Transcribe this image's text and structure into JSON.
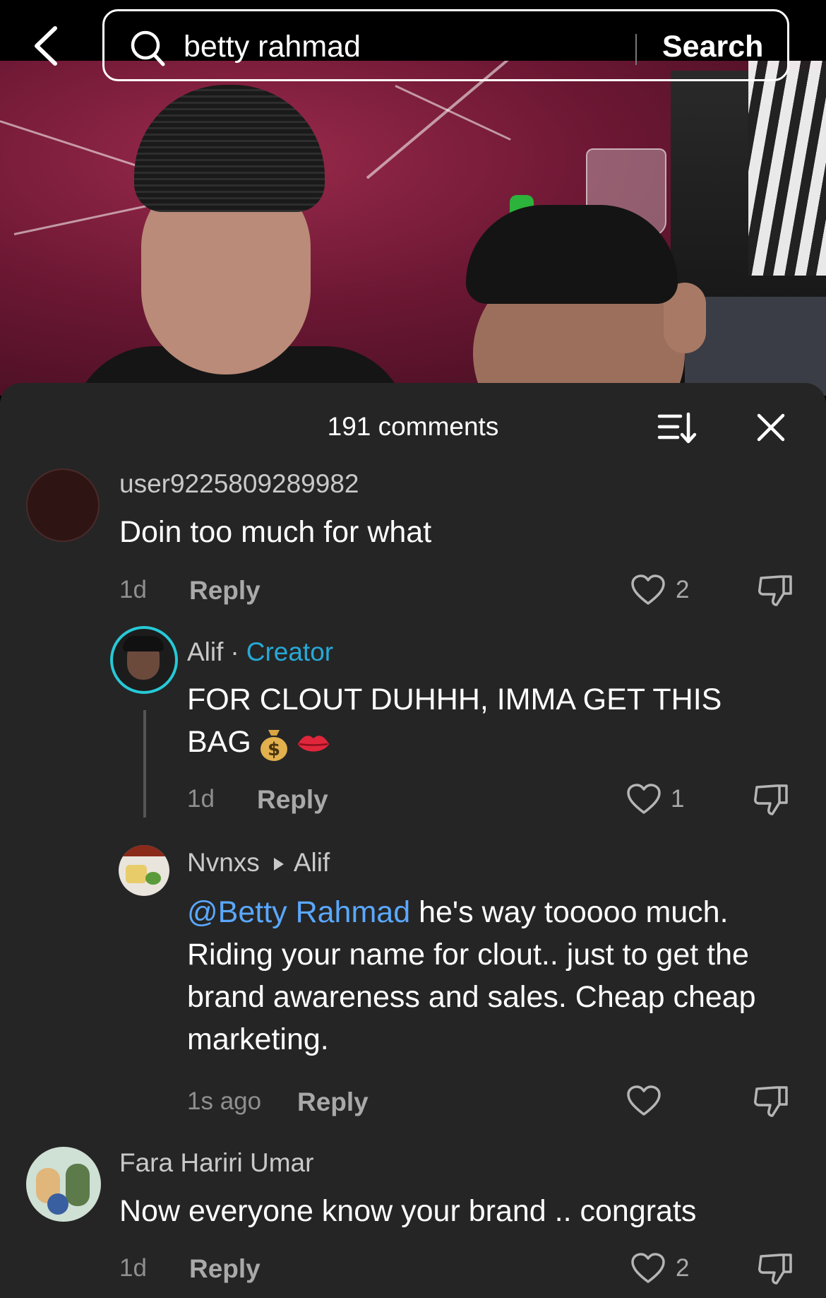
{
  "search": {
    "query": "betty rahmad",
    "button_label": "Search"
  },
  "comments_sheet": {
    "title": "191 comments"
  },
  "comments": [
    {
      "username": "user9225809289982",
      "text": "Doin too much for what",
      "time": "1d",
      "reply_label": "Reply",
      "likes": "2"
    },
    {
      "username": "Alif",
      "separator": "·",
      "badge": "Creator",
      "text": "FOR CLOUT DUHHH, IMMA GET THIS BAG",
      "time": "1d",
      "reply_label": "Reply",
      "likes": "1"
    },
    {
      "username": "Nvnxs",
      "reply_to": "Alif",
      "mention": "@Betty Rahmad",
      "text": " he's way tooooo much. Riding your name for clout.. just to get the brand awareness and sales. Cheap cheap marketing.",
      "time": "1s ago",
      "reply_label": "Reply",
      "likes": ""
    },
    {
      "username": "Fara Hariri Umar",
      "text": "Now everyone know your brand .. congrats",
      "time": "1d",
      "reply_label": "Reply",
      "likes": "2"
    }
  ],
  "icons": {
    "back": "chevron-left-icon",
    "search": "search-icon",
    "sort": "sort-icon",
    "close": "close-icon",
    "like": "heart-icon",
    "dislike": "thumbs-down-icon",
    "emoji_1": "money-bag-emoji",
    "emoji_2": "kiss-lips-emoji"
  },
  "colors": {
    "sheet_background": "#252525",
    "creator_badge": "#27a9d7",
    "mention": "#5aa8ff",
    "username": "#c9c9c9",
    "meta": "#8f8f8f"
  }
}
